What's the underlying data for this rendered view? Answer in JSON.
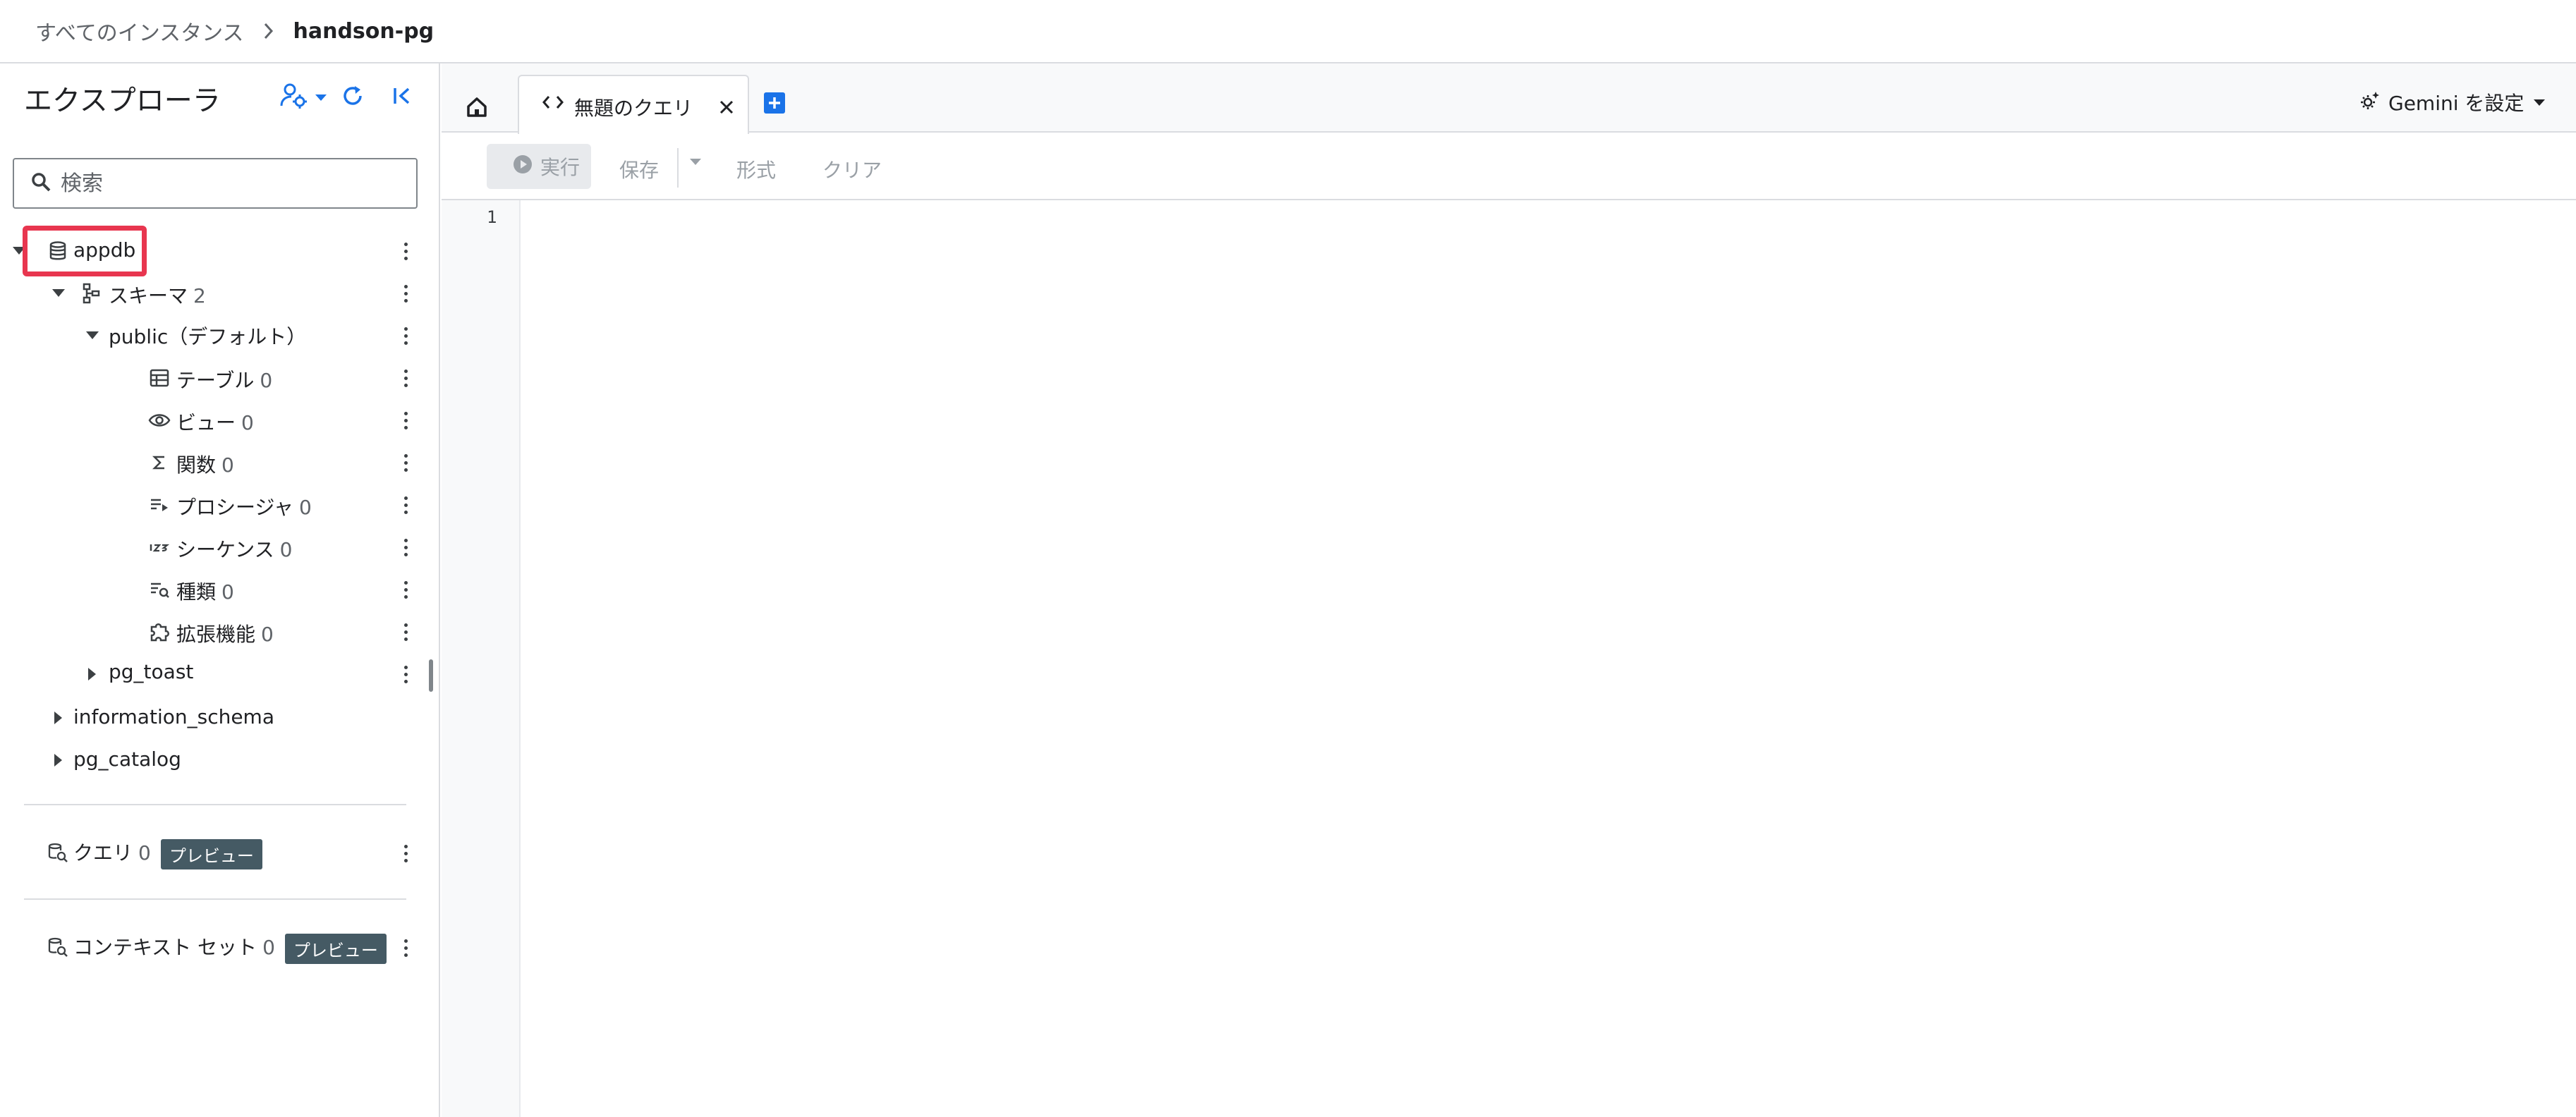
{
  "breadcrumb": {
    "root": "すべてのインスタンス",
    "current": "handson-pg"
  },
  "explorer": {
    "title": "エクスプローラ",
    "search_placeholder": "検索",
    "tree": {
      "database": {
        "label": "appdb"
      },
      "schemas": {
        "label": "スキーマ",
        "count": "2"
      },
      "public": {
        "label": "public（デフォルト）"
      },
      "items": [
        {
          "label": "テーブル",
          "count": "0",
          "icon": "table-icon"
        },
        {
          "label": "ビュー",
          "count": "0",
          "icon": "eye-icon"
        },
        {
          "label": "関数",
          "count": "0",
          "icon": "sigma-icon"
        },
        {
          "label": "プロシージャ",
          "count": "0",
          "icon": "procedure-icon"
        },
        {
          "label": "シーケンス",
          "count": "0",
          "icon": "sequence-icon"
        },
        {
          "label": "種類",
          "count": "0",
          "icon": "type-icon"
        },
        {
          "label": "拡張機能",
          "count": "0",
          "icon": "extension-icon"
        }
      ],
      "pg_toast": {
        "label": "pg_toast"
      },
      "information_schema": {
        "label": "information_schema"
      },
      "pg_catalog": {
        "label": "pg_catalog"
      }
    },
    "queries": {
      "label": "クエリ",
      "count": "0",
      "badge": "プレビュー"
    },
    "context_sets": {
      "label": "コンテキスト セット",
      "count": "0",
      "badge": "プレビュー"
    }
  },
  "tabs": {
    "query_tab_label": "無題のクエリ"
  },
  "gemini": {
    "label": "Gemini を設定"
  },
  "toolbar": {
    "run": "実行",
    "save": "保存",
    "format": "形式",
    "clear": "クリア"
  },
  "editor": {
    "line_numbers": [
      "1"
    ]
  },
  "colors": {
    "accent_blue": "#1a73e8",
    "highlight_red": "#e8364f",
    "badge_bg": "#455a64"
  }
}
